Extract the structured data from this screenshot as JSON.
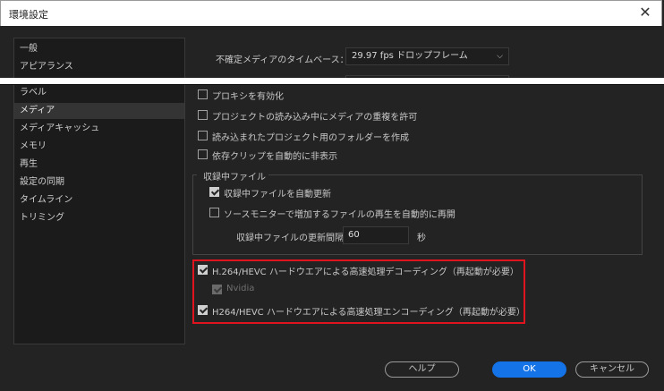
{
  "window": {
    "title": "環境設定",
    "close_glyph": "✕"
  },
  "sidebar": {
    "items": [
      {
        "label": "一般"
      },
      {
        "label": "アピアランス"
      },
      {
        "label": "ラベル"
      },
      {
        "label": "メディア",
        "selected": true
      },
      {
        "label": "メディアキャッシュ"
      },
      {
        "label": "メモリ"
      },
      {
        "label": "再生"
      },
      {
        "label": "設定の同期"
      },
      {
        "label": "タイムライン"
      },
      {
        "label": "トリミング"
      }
    ]
  },
  "media": {
    "timebase_label": "不確定メディアのタイムベース：",
    "timebase_value": "29.97 fps ドロップフレーム",
    "checkboxes": [
      {
        "label": "プロキシを有効化",
        "checked": false
      },
      {
        "label": "プロジェクトの読み込み中にメディアの重複を許可",
        "checked": false
      },
      {
        "label": "読み込まれたプロジェクト用のフォルダーを作成",
        "checked": false
      },
      {
        "label": "依存クリップを自動的に非表示",
        "checked": false
      }
    ],
    "growing": {
      "group_title": "収録中ファイル",
      "auto_refresh_label": "収録中ファイルを自動更新",
      "auto_refresh_checked": true,
      "source_monitor_label": "ソースモニターで増加するファイルの再生を自動的に再開",
      "source_monitor_checked": false,
      "interval_label": "収録中ファイルの更新間隔",
      "interval_value": "60",
      "interval_unit": "秒"
    },
    "hardware": {
      "decode_label": "H.264/HEVC ハードウエアによる高速処理デコーディング（再起動が必要）",
      "decode_checked": true,
      "nvidia_label": "Nvidia",
      "nvidia_checked": true,
      "encode_label": "H264/HEVC ハードウエアによる高速処理エンコーディング（再起動が必要）",
      "encode_checked": true
    }
  },
  "footer": {
    "help_label": "ヘルプ",
    "ok_label": "OK",
    "cancel_label": "キャンセル"
  },
  "colors": {
    "accent": "#1473e6",
    "highlight": "#e0141e"
  }
}
